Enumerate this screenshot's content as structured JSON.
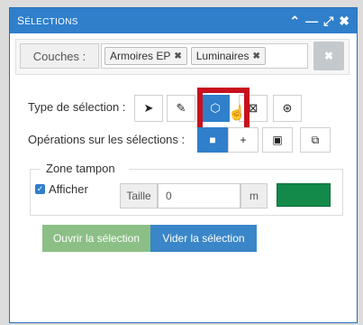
{
  "panel": {
    "title_first": "S",
    "title_rest": "ÉLECTIONS",
    "icons": [
      "chevron-up-icon",
      "minimize-icon",
      "expand-icon",
      "close-icon"
    ]
  },
  "layers": {
    "label": "Couches :",
    "tags": [
      {
        "label": "Armoires EP"
      },
      {
        "label": "Luminaires"
      }
    ],
    "remove_symbol": "✖",
    "clear_symbol": "✖"
  },
  "selection_type": {
    "label": "Type de sélection :",
    "tools": [
      "pointer-icon",
      "line-select-icon",
      "polygon-select-icon",
      "box-select-icon",
      "circle-select-icon"
    ],
    "active_index": 2
  },
  "operations": {
    "label": "Opérations sur les sélections :",
    "buttons": [
      "new-selection-icon",
      "add-selection-icon",
      "intersect-selection-icon",
      "subtract-selection-icon"
    ],
    "symbols": [
      "■",
      "+",
      "▣",
      "⧉"
    ],
    "active_index": 0
  },
  "buffer": {
    "legend": "Zone tampon",
    "show_label": "Afficher",
    "size_label": "Taille",
    "size_value": "0",
    "unit": "m",
    "color": "#13894a"
  },
  "actions": {
    "open_label": "Ouvrir la sélection",
    "empty_label": "Vider la sélection"
  }
}
